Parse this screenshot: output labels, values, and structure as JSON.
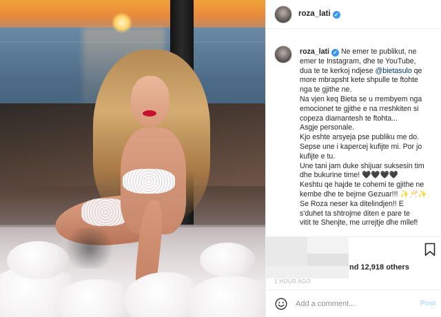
{
  "post": {
    "username": "roza_lati",
    "verified_icon": "verified-badge-icon",
    "caption_lines": [
      "Ne emer te publikut, ne",
      "emer te Instagram, dhe te YouTube,",
      "dua te te kerkoj ndjese ",
      "more mbrapsht kete shpulle te ftohte",
      "nga te gjithe ne.",
      "Na vjen keq Bieta se u rrembyem nga",
      "emocionet te gjithe e na rreshkiten si",
      "copeza diamantesh te ftohta...",
      "Asgje personale.",
      "Kjo eshte arsyeja pse publiku me do.",
      "Sepse une i kapercej kufijte mi. Por jo",
      "kufijte e tu.",
      "Une tani jam duke shijuar suksesin tim",
      "dhe bukurine time! 🖤🖤🖤🖤",
      "Keshtu qe hajde te cohemi te gjithe ne",
      "kembe dhe te bejme Gezuar!!! ✨🥂✨",
      "Se Roza neser ka ditelindjen!! E",
      "s'duhet ta shtrojme diten e pare te",
      "vitit te Shenjte, me urrejtje dhe mllef!"
    ],
    "mention": "@bietasulo",
    "mention_suffix": " qe",
    "likes_text": "nd 12,918 others",
    "time_text": "1 HOUR AGO"
  },
  "actions": {
    "bookmark_icon": "bookmark-icon",
    "emoji_icon": "emoji-smile-icon",
    "comment_placeholder": "Add a comment...",
    "post_label": "Post"
  },
  "colors": {
    "verified_blue": "#3897f0",
    "post_disabled": "#b2dffc",
    "mention": "#003569"
  }
}
